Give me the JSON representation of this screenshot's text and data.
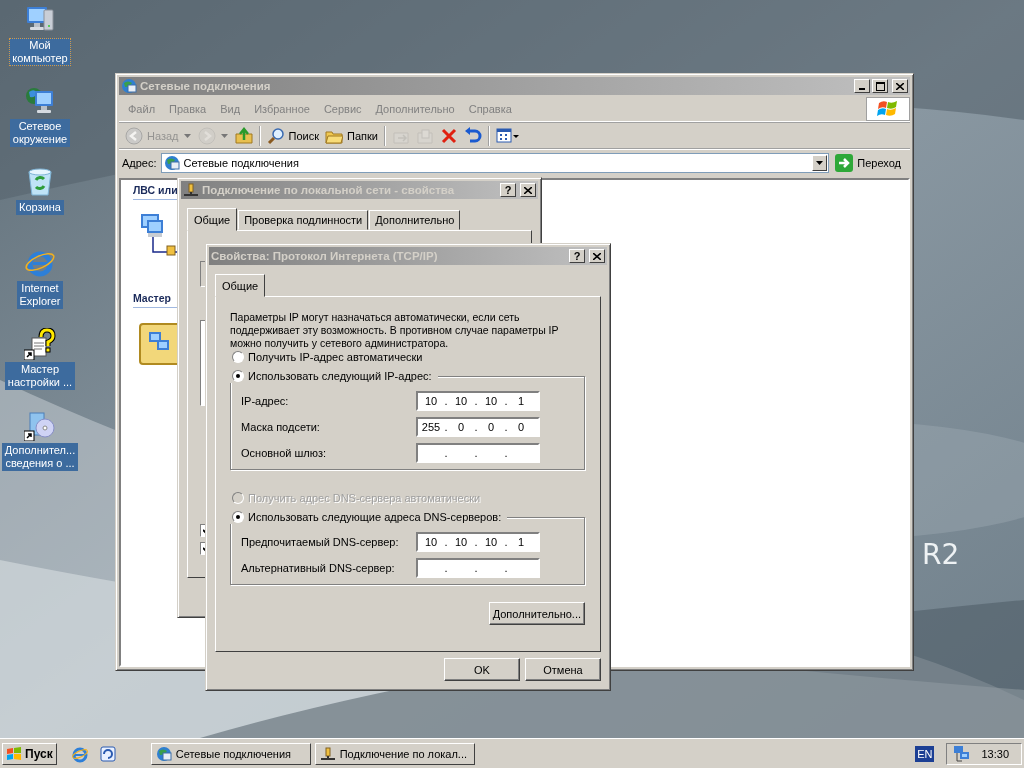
{
  "desktop": {
    "icons": [
      {
        "lines": [
          "Мой",
          "компьютер"
        ],
        "focused": true,
        "kind": "computer"
      },
      {
        "lines": [
          "Сетевое",
          "окружение"
        ],
        "focused": false,
        "kind": "network"
      },
      {
        "lines": [
          "Корзина"
        ],
        "focused": false,
        "kind": "recycle"
      },
      {
        "lines": [
          "Internet",
          "Explorer"
        ],
        "focused": false,
        "kind": "browser"
      },
      {
        "lines": [
          "Мастер",
          "настройки ..."
        ],
        "focused": false,
        "kind": "help"
      },
      {
        "lines": [
          "Дополнител...",
          "сведения о ..."
        ],
        "focused": false,
        "kind": "disc"
      }
    ],
    "wallpaper_text": "R2"
  },
  "explorer": {
    "title": "Сетевые подключения",
    "menu": [
      "Файл",
      "Правка",
      "Вид",
      "Избранное",
      "Сервис",
      "Дополнительно",
      "Справка"
    ],
    "toolbar": [
      {
        "kind": "back",
        "label": "Назад",
        "disabled": true
      },
      {
        "kind": "forward",
        "disabled": true
      },
      {
        "kind": "up",
        "disabled": false
      },
      {
        "kind": "separator"
      },
      {
        "kind": "search",
        "label": "Поиск",
        "disabled": false
      },
      {
        "kind": "folders",
        "label": "Папки",
        "disabled": false
      },
      {
        "kind": "separator"
      },
      {
        "kind": "move",
        "disabled": true
      },
      {
        "kind": "copy",
        "disabled": true
      },
      {
        "kind": "delete",
        "disabled": false
      },
      {
        "kind": "undo",
        "disabled": false
      },
      {
        "kind": "separator"
      },
      {
        "kind": "views",
        "disabled": false
      }
    ],
    "address": {
      "label": "Адрес:",
      "value": "Сетевые подключения",
      "go": "Переход"
    },
    "tasks_pane": [
      {
        "heading": "ЛВС или",
        "kind": "lan"
      },
      {
        "heading": "Мастер",
        "kind": "wizard"
      }
    ]
  },
  "lan_dialog": {
    "title": "Подключение по локальной сети - свойства",
    "help_button": "?",
    "tabs": [
      {
        "label": "Общие",
        "selected": true
      },
      {
        "label": "Проверка подлинности",
        "selected": false
      },
      {
        "label": "Дополнительно",
        "selected": false
      }
    ],
    "checkboxes": [
      {
        "checked": true
      },
      {
        "checked": true
      }
    ]
  },
  "tcpip_dialog": {
    "title": "Свойства: Протокол Интернета (TCP/IP)",
    "help_button": "?",
    "tabs": [
      {
        "label": "Общие",
        "selected": true
      }
    ],
    "description": "Параметры IP могут назначаться автоматически, если сеть поддерживает эту возможность. В противном случае параметры IP можно получить у сетевого администратора.",
    "separator": ".",
    "ip_options": [
      {
        "label": "Получить IP-адрес автоматически",
        "selected": false,
        "disabled": false
      },
      {
        "label": "Использовать следующий IP-адрес:",
        "selected": true,
        "disabled": false
      }
    ],
    "ip_fields": [
      {
        "label": "IP-адрес:",
        "octets": [
          "10",
          "10",
          "10",
          "1"
        ]
      },
      {
        "label": "Маска подсети:",
        "octets": [
          "255",
          "0",
          "0",
          "0"
        ]
      },
      {
        "label": "Основной шлюз:"
      }
    ],
    "dns_options": [
      {
        "label": "Получить адрес DNS-сервера автоматически",
        "selected": false,
        "disabled": true
      },
      {
        "label": "Использовать следующие адреса DNS-серверов:",
        "selected": true,
        "disabled": false
      }
    ],
    "dns_fields": [
      {
        "label": "Предпочитаемый DNS-сервер:",
        "octets": [
          "10",
          "10",
          "10",
          "1"
        ]
      },
      {
        "label": "Альтернативный DNS-сервер:"
      }
    ],
    "advanced_button": "Дополнительно...",
    "buttons": [
      "OK",
      "Отмена"
    ]
  },
  "taskbar": {
    "start": "Пуск",
    "tasks": [
      {
        "label": "Сетевые подключения",
        "kind": "network",
        "selected": false
      },
      {
        "label": "Подключение по локал...",
        "kind": "lan",
        "selected": false
      }
    ],
    "language": "EN",
    "clock": "13:30"
  }
}
